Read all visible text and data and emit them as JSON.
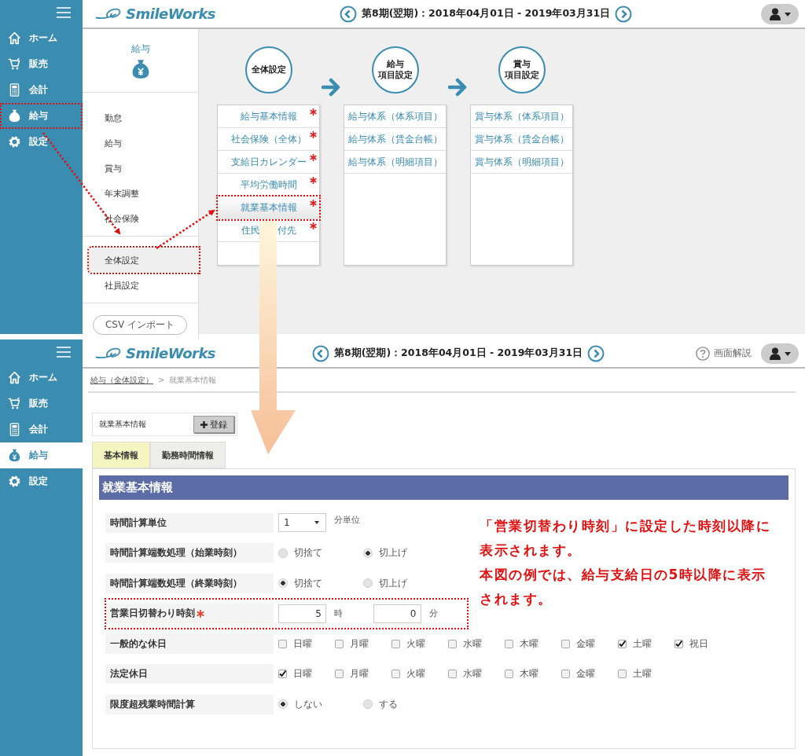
{
  "overview_screen": {
    "header": {
      "logo": "SmileWorks",
      "period": "第8期(翌期)：2018年04月01日 - 2019年03月31日"
    },
    "sidebar": {
      "items": [
        {
          "label": "ホーム",
          "selected": false,
          "highlighted": false
        },
        {
          "label": "販売",
          "selected": false,
          "highlighted": false
        },
        {
          "label": "会計",
          "selected": false,
          "highlighted": false
        },
        {
          "label": "給与",
          "selected": false,
          "highlighted": true
        },
        {
          "label": "設定",
          "selected": false,
          "highlighted": false
        }
      ]
    },
    "submenu": {
      "title": "給与",
      "groups": [
        [
          {
            "label": "勤怠",
            "selected": false,
            "highlighted": false
          },
          {
            "label": "給与",
            "selected": false,
            "highlighted": false
          },
          {
            "label": "賞与",
            "selected": false,
            "highlighted": false
          },
          {
            "label": "年末調整",
            "selected": false,
            "highlighted": false
          },
          {
            "label": "社会保険",
            "selected": false,
            "highlighted": false
          }
        ],
        [
          {
            "label": "全体設定",
            "selected": true,
            "highlighted": true
          },
          {
            "label": "社員設定",
            "selected": false,
            "highlighted": false
          }
        ]
      ],
      "import_button": "CSV インポート"
    },
    "steps": [
      {
        "title": [
          "全体設定"
        ],
        "items": [
          {
            "parts": [
              "給与基本情報"
            ],
            "required": true,
            "highlighted": false
          },
          {
            "parts": [
              "社会保険（全体）"
            ],
            "required": true,
            "highlighted": false
          },
          {
            "parts": [
              "支給日カレンダー"
            ],
            "required": true,
            "highlighted": false
          },
          {
            "parts": [
              "平均労働時間"
            ],
            "required": true,
            "highlighted": false
          },
          {
            "parts": [
              "就業基本情報"
            ],
            "required": true,
            "highlighted": true
          },
          {
            "parts": [
              "住民",
              "付先"
            ],
            "required": true,
            "highlighted": false
          }
        ]
      },
      {
        "title": [
          "給与",
          "項目設定"
        ],
        "items": [
          {
            "parts": [
              "給与体系（体系項目）"
            ],
            "required": false,
            "highlighted": false
          },
          {
            "parts": [
              "給与体系（賃金台帳）"
            ],
            "required": false,
            "highlighted": false
          },
          {
            "parts": [
              "給与体系（明細項目）"
            ],
            "required": false,
            "highlighted": false
          }
        ]
      },
      {
        "title": [
          "賞与",
          "項目設定"
        ],
        "items": [
          {
            "parts": [
              "賞与体系（体系項目）"
            ],
            "required": false,
            "highlighted": false
          },
          {
            "parts": [
              "賞与体系（賃金台帳）"
            ],
            "required": false,
            "highlighted": false
          },
          {
            "parts": [
              "賞与体系（明細項目）"
            ],
            "required": false,
            "highlighted": false
          }
        ]
      }
    ]
  },
  "detail_screen": {
    "header": {
      "logo": "SmileWorks",
      "period": "第8期(翌期)：2018年04月01日 - 2019年03月31日",
      "help": "画面解説"
    },
    "sidebar": {
      "items": [
        {
          "label": "ホーム",
          "selected": false,
          "highlighted": false
        },
        {
          "label": "販売",
          "selected": false,
          "highlighted": false
        },
        {
          "label": "会計",
          "selected": false,
          "highlighted": false
        },
        {
          "label": "給与",
          "selected": true,
          "highlighted": false
        },
        {
          "label": "設定",
          "selected": false,
          "highlighted": false
        }
      ]
    },
    "breadcrumb": {
      "link": "給与（全体設定）",
      "separator": ">",
      "current": "就業基本情報"
    },
    "record_bar": {
      "title": "就業基本情報",
      "button": "登録"
    },
    "tabs": [
      {
        "label": "基本情報",
        "selected": true
      },
      {
        "label": "勤務時間情報",
        "selected": false
      }
    ],
    "section": {
      "title": "就業基本情報",
      "rows": [
        {
          "kind": "select",
          "label": "時間計算単位",
          "required": false,
          "highlighted": false,
          "value": "1",
          "unit": "分単位"
        },
        {
          "kind": "radio",
          "label": "時間計算端数処理（始業時刻）",
          "required": false,
          "highlighted": false,
          "options": [
            {
              "label": "切捨て",
              "selected": false
            },
            {
              "label": "切上げ",
              "selected": true
            }
          ]
        },
        {
          "kind": "radio",
          "label": "時間計算端数処理（終業時刻）",
          "required": false,
          "highlighted": false,
          "options": [
            {
              "label": "切捨て",
              "selected": true
            },
            {
              "label": "切上げ",
              "selected": false
            }
          ]
        },
        {
          "kind": "time",
          "label": "営業日切替わり時刻",
          "required": true,
          "highlighted": true,
          "fields": [
            {
              "value": "5",
              "unit": "時"
            },
            {
              "value": "0",
              "unit": "分"
            }
          ]
        },
        {
          "kind": "checkbox",
          "label": "一般的な休日",
          "required": false,
          "highlighted": false,
          "options": [
            {
              "label": "日曜",
              "checked": false
            },
            {
              "label": "月曜",
              "checked": false
            },
            {
              "label": "火曜",
              "checked": false
            },
            {
              "label": "水曜",
              "checked": false
            },
            {
              "label": "木曜",
              "checked": false
            },
            {
              "label": "金曜",
              "checked": false
            },
            {
              "label": "土曜",
              "checked": true
            },
            {
              "label": "祝日",
              "checked": true
            }
          ]
        },
        {
          "kind": "checkbox",
          "label": "法定休日",
          "required": false,
          "highlighted": false,
          "options": [
            {
              "label": "日曜",
              "checked": true
            },
            {
              "label": "月曜",
              "checked": false
            },
            {
              "label": "火曜",
              "checked": false
            },
            {
              "label": "水曜",
              "checked": false
            },
            {
              "label": "木曜",
              "checked": false
            },
            {
              "label": "金曜",
              "checked": false
            },
            {
              "label": "土曜",
              "checked": false
            }
          ]
        },
        {
          "kind": "radio",
          "label": "限度超残業時間計算",
          "required": false,
          "highlighted": false,
          "options": [
            {
              "label": "しない",
              "selected": true
            },
            {
              "label": "する",
              "selected": false
            }
          ]
        }
      ]
    }
  },
  "annotation": {
    "paragraphs": [
      "「営業切替わり時刻」に設定した時刻以降に表示されます。",
      "本図の例では、給与支給日の5時以降に表示されます。"
    ]
  }
}
